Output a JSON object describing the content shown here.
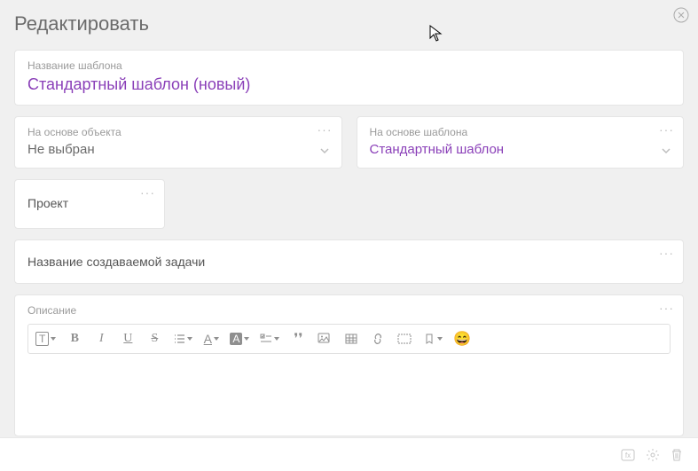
{
  "title": "Редактировать",
  "templateName": {
    "label": "Название шаблона",
    "value": "Стандартный шаблон (новый)"
  },
  "baseObject": {
    "label": "На основе объекта",
    "value": "Не выбран"
  },
  "baseTemplate": {
    "label": "На основе шаблона",
    "value": "Стандартный шаблон"
  },
  "project": {
    "label": "Проект"
  },
  "taskName": {
    "placeholder": "Название создаваемой задачи"
  },
  "description": {
    "label": "Описание"
  },
  "toolbar": {
    "text": "T",
    "bold": "B",
    "italic": "I",
    "underline": "U",
    "strike": "S",
    "textcolor": "A",
    "bgcolor": "A",
    "quote": "❜❜"
  }
}
